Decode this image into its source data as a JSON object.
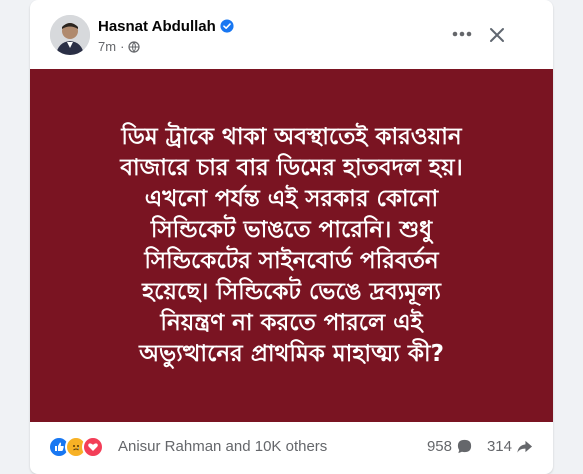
{
  "post": {
    "author": "Hasnat Abdullah",
    "verified_icon": "verified-badge-icon",
    "time": "7m",
    "privacy_icon": "globe-icon",
    "text": "ডিম ট্রাকে থাকা অবস্থাতেই কারওয়ান\nবাজারে চার বার ডিমের হাতবদল হয়।\nএখনো পর্যন্ত এই সরকার কোনো\nসিন্ডিকেট ভাঙতে পারেনি। শুধু\nসিন্ডিকেটের সাইনবোর্ড পরিবর্তন\nহয়েছে। সিন্ডিকেট ভেঙে দ্রব্যমূল্য\nনিয়ন্ত্রণ না করতে পারলে এই\nঅভ্যুত্থানের প্রাথমিক মাহাত্ম্য কী?",
    "background_color": "#7a1422",
    "text_color": "#ffffff"
  },
  "header_actions": {
    "more_icon": "more-dots-icon",
    "close_icon": "close-icon"
  },
  "footer": {
    "reaction_icons": [
      "like-icon",
      "love-icon",
      "sad-icon"
    ],
    "reaction_summary": "Anisur Rahman and 10K others",
    "comments_count": "958",
    "comment_icon": "comment-bubble-icon",
    "shares_count": "314",
    "share_icon": "share-arrow-icon"
  },
  "colors": {
    "like": "#1877f2",
    "love": "#f33e58",
    "sad": "#f7b125",
    "verified": "#1877f2"
  }
}
